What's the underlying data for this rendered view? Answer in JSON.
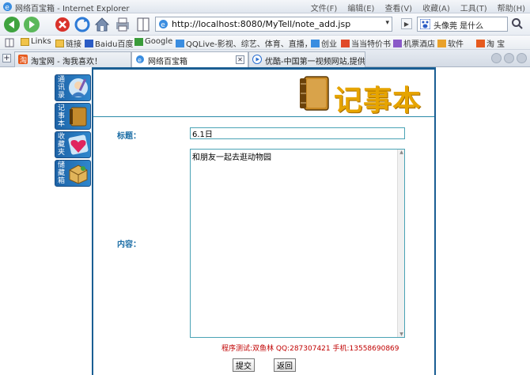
{
  "window": {
    "title": "网络百宝箱 - Internet Explorer",
    "menu": [
      "文件(F)",
      "编辑(E)",
      "查看(V)",
      "收藏(A)",
      "工具(T)",
      "帮助(H)"
    ]
  },
  "address": {
    "url": "http://localhost:8080/MyTell/note_add.jsp"
  },
  "search": {
    "query": "头像莞 是什么"
  },
  "favorites": [
    "Links",
    "链接",
    "Baidu百度",
    "Google",
    "QQLive-影视、综艺、体育、直播，...",
    "创业",
    "当当特价书",
    "机票酒店",
    "软件",
    "淘 宝"
  ],
  "tabs": [
    {
      "label": "淘宝网 - 淘我喜欢！"
    },
    {
      "label": "网络百宝箱"
    },
    {
      "label": "优酷-中国第一视频网站,提供..."
    }
  ],
  "sidebar": [
    "通讯录",
    "记事本",
    "收藏夹",
    "储藏箱"
  ],
  "page": {
    "logo_text": "记事本",
    "title_label": "标题：",
    "title_value": "6.1日",
    "content_label": "内容：",
    "content_value": "和朋友一起去逛动物园",
    "credit": "程序测试:双鱼林  QQ:287307421  手机:13558690869",
    "submit_label": "提交",
    "back_label": "返回"
  },
  "colors": {
    "accent": "#1c6ea6",
    "logo": "#e6a400",
    "credit": "#c00000"
  }
}
